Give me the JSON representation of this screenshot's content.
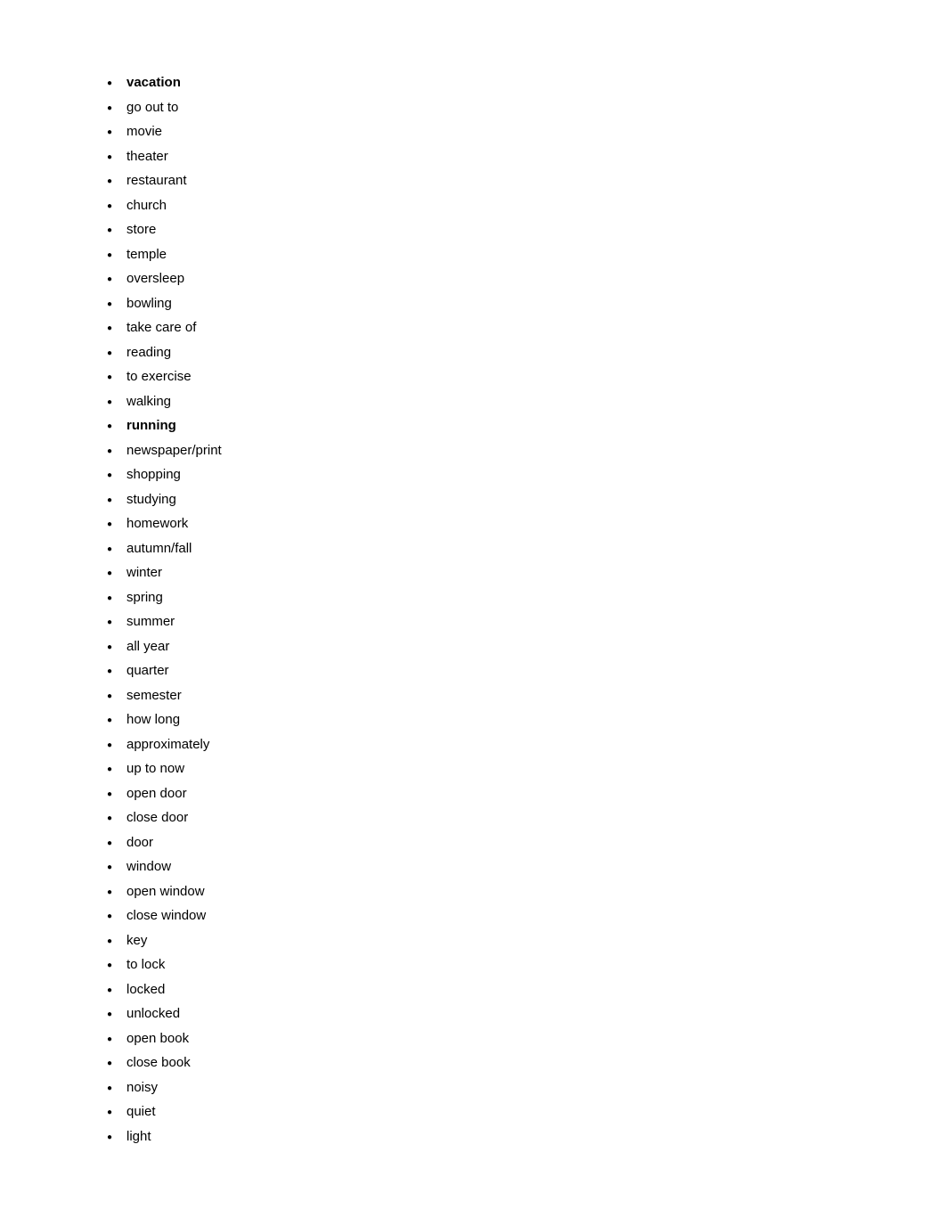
{
  "list": {
    "items": [
      {
        "text": "vacation",
        "bold": true
      },
      {
        "text": "go out to",
        "bold": false
      },
      {
        "text": "movie",
        "bold": false
      },
      {
        "text": "theater",
        "bold": false
      },
      {
        "text": "restaurant",
        "bold": false
      },
      {
        "text": "church",
        "bold": false
      },
      {
        "text": "store",
        "bold": false
      },
      {
        "text": "temple",
        "bold": false
      },
      {
        "text": "oversleep",
        "bold": false
      },
      {
        "text": "bowling",
        "bold": false
      },
      {
        "text": "take care of",
        "bold": false
      },
      {
        "text": "reading",
        "bold": false
      },
      {
        "text": "to exercise",
        "bold": false
      },
      {
        "text": "walking",
        "bold": false
      },
      {
        "text": "running",
        "bold": true
      },
      {
        "text": "newspaper/print",
        "bold": false
      },
      {
        "text": "shopping",
        "bold": false
      },
      {
        "text": "studying",
        "bold": false
      },
      {
        "text": "homework",
        "bold": false
      },
      {
        "text": "autumn/fall",
        "bold": false
      },
      {
        "text": "winter",
        "bold": false
      },
      {
        "text": "spring",
        "bold": false
      },
      {
        "text": "summer",
        "bold": false
      },
      {
        "text": "all year",
        "bold": false
      },
      {
        "text": "quarter",
        "bold": false
      },
      {
        "text": "semester",
        "bold": false
      },
      {
        "text": "how long",
        "bold": false
      },
      {
        "text": "approximately",
        "bold": false
      },
      {
        "text": "up to now",
        "bold": false
      },
      {
        "text": "open door",
        "bold": false
      },
      {
        "text": "close door",
        "bold": false
      },
      {
        "text": "door",
        "bold": false
      },
      {
        "text": "window",
        "bold": false
      },
      {
        "text": "open window",
        "bold": false
      },
      {
        "text": "close window",
        "bold": false
      },
      {
        "text": "key",
        "bold": false
      },
      {
        "text": "to lock",
        "bold": false
      },
      {
        "text": "locked",
        "bold": false
      },
      {
        "text": "unlocked",
        "bold": false
      },
      {
        "text": "open book",
        "bold": false
      },
      {
        "text": "close book",
        "bold": false
      },
      {
        "text": "noisy",
        "bold": false
      },
      {
        "text": "quiet",
        "bold": false
      },
      {
        "text": "light",
        "bold": false
      }
    ]
  }
}
